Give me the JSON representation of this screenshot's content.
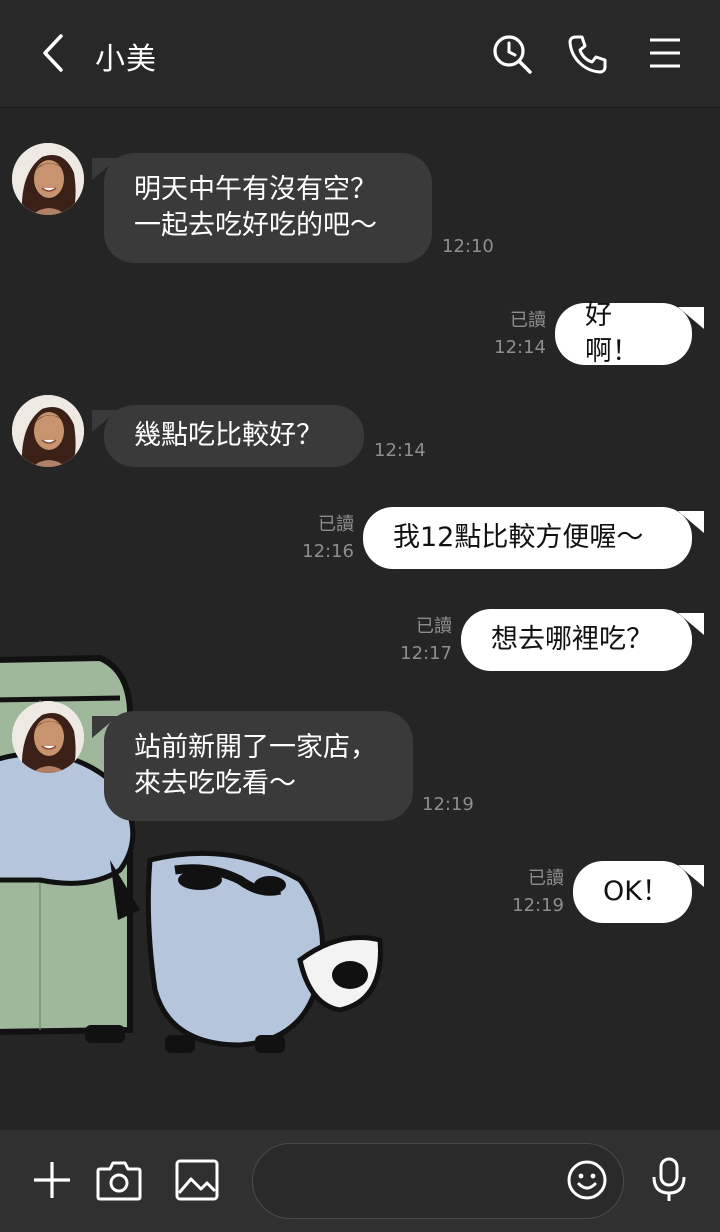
{
  "header": {
    "title": "小美",
    "icons": [
      "back-icon",
      "search-history-icon",
      "phone-icon",
      "menu-icon"
    ]
  },
  "colors": {
    "background": "#252525",
    "incoming_bubble": "#3a3a3a",
    "outgoing_bubble": "#ffffff",
    "meta_text": "#8e8e8e"
  },
  "messages": [
    {
      "direction": "in",
      "text": "明天中午有沒有空？\n一起去吃好吃的吧～",
      "time": "12:10"
    },
    {
      "direction": "out",
      "text": "好啊！",
      "read": "已讀",
      "time": "12:14"
    },
    {
      "direction": "in",
      "text": "幾點吃比較好？",
      "time": "12:14"
    },
    {
      "direction": "out",
      "text": "我12點比較方便喔～",
      "read": "已讀",
      "time": "12:16"
    },
    {
      "direction": "out",
      "text": "想去哪裡吃？",
      "read": "已讀",
      "time": "12:17"
    },
    {
      "direction": "in",
      "text": "站前新開了一家店，\n來去吃吃看～",
      "time": "12:19"
    },
    {
      "direction": "out",
      "text": "OK！",
      "read": "已讀",
      "time": "12:19"
    }
  ],
  "composer": {
    "placeholder": "",
    "icons": [
      "plus-icon",
      "camera-icon",
      "image-icon",
      "emoji-icon",
      "microphone-icon"
    ]
  }
}
